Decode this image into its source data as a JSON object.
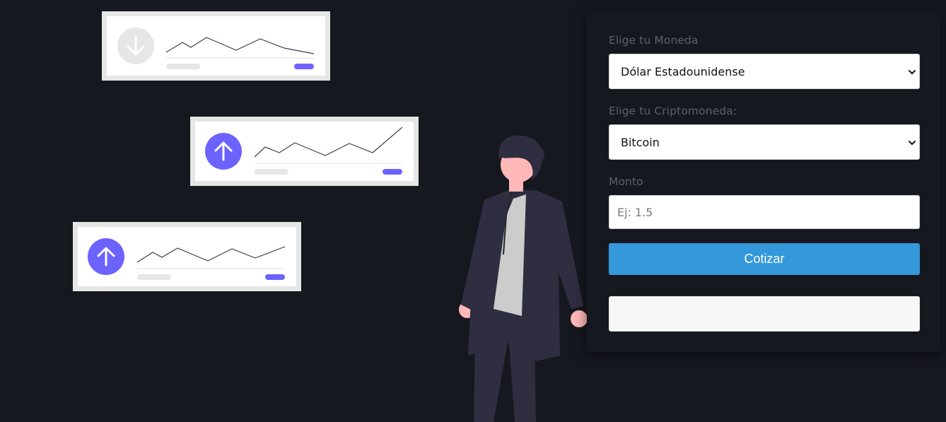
{
  "form": {
    "currency_label": "Elige tu Moneda",
    "currency_selected": "Dólar Estadounidense",
    "crypto_label": "Elige tu Criptomoneda:",
    "crypto_selected": "Bitcoin",
    "amount_label": "Monto",
    "amount_value": "",
    "amount_placeholder": "Ej: 1.5",
    "submit_label": "Cotizar",
    "result_text": ""
  },
  "illustration": {
    "cards": [
      {
        "trend": "down",
        "icon": "arrow-down-icon",
        "accent": "#e6e6e6"
      },
      {
        "trend": "up",
        "icon": "arrow-up-icon",
        "accent": "#6c63ff"
      },
      {
        "trend": "up",
        "icon": "arrow-up-icon",
        "accent": "#6c63ff"
      }
    ]
  },
  "colors": {
    "background": "#161820",
    "button": "#3498db",
    "accent": "#6c63ff",
    "label": "#5e616b"
  }
}
